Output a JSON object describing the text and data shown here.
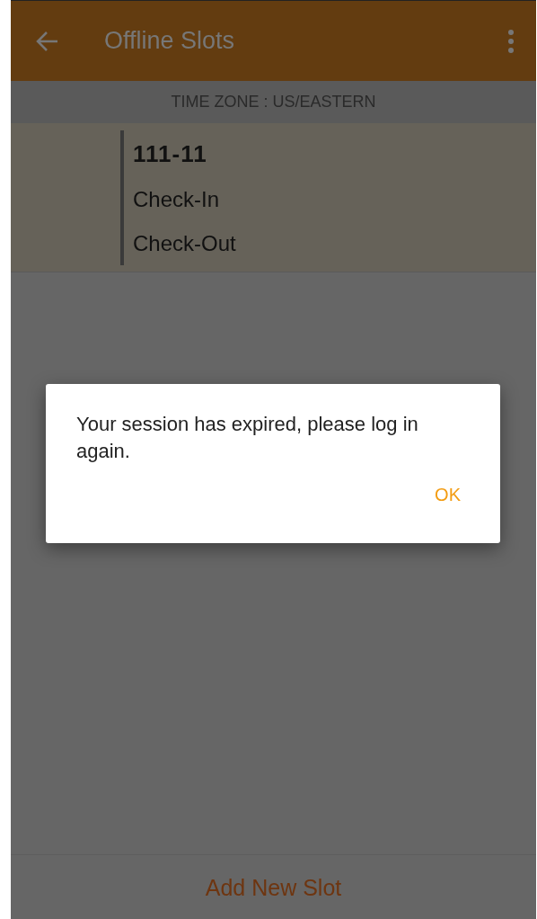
{
  "app_bar": {
    "title": "Offline Slots"
  },
  "time_zone": "TIME ZONE : US/EASTERN",
  "slots": [
    {
      "id": "111-11",
      "check_in": "Check-In",
      "check_out": "Check-Out"
    }
  ],
  "add_button": "Add New Slot",
  "dialog": {
    "message": "Your session has expired, please log in again.",
    "button": "OK"
  }
}
